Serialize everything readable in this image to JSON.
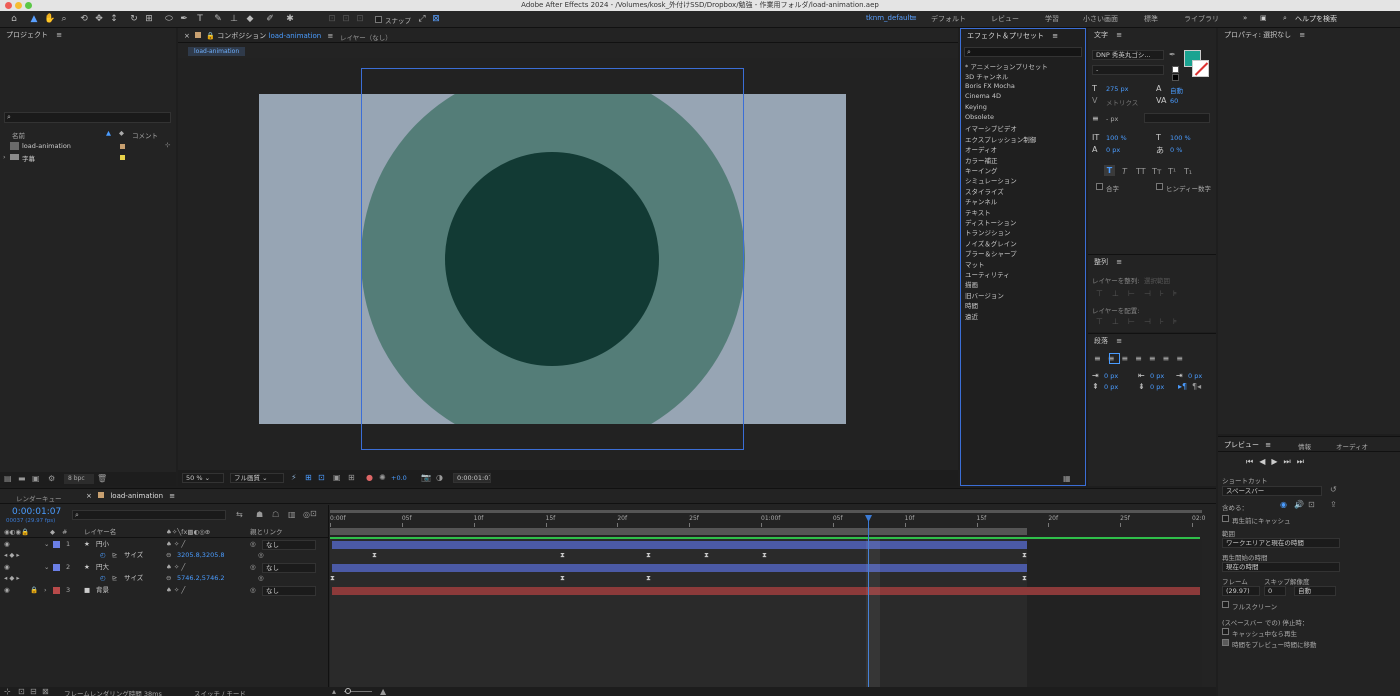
{
  "window": {
    "title": "Adobe After Effects 2024 - /Volumes/kosk_外付けSSD/Dropbox/勉強 - 作業用フォルダ/load-animation.aep"
  },
  "toolbar": {
    "snap_label": "スナップ",
    "workspaces": [
      "tknm_default",
      "デフォルト",
      "レビュー",
      "学習",
      "小さい画面",
      "標準",
      "ライブラリ"
    ],
    "active_workspace": "tknm_default",
    "help_placeholder": "ヘルプを検索"
  },
  "project": {
    "title": "プロジェクト",
    "search_placeholder": "",
    "col_name": "名前",
    "col_comment": "コメント",
    "items": [
      {
        "name": "load-animation",
        "type": "composition",
        "label_color": "#c8a070"
      },
      {
        "name": "字幕",
        "type": "folder",
        "label_color": "#e8d24a"
      }
    ],
    "bpc": "8 bpc"
  },
  "composition": {
    "tab_title": "コンポジション",
    "tab_name": "load-animation",
    "layer_tab": "レイヤー（なし）",
    "breadcrumb": "load-animation",
    "zoom": "50 %",
    "quality": "フル画質",
    "exposure": "+0.0",
    "timecode": "0:00:01:07",
    "colors": {
      "background": "#97a5b4",
      "outer_circle": "#547d78",
      "inner_circle": "#123a34"
    }
  },
  "effects": {
    "title": "エフェクト＆プリセット",
    "items": [
      "* アニメーションプリセット",
      "3D チャンネル",
      "Boris FX Mocha",
      "Cinema 4D",
      "Keying",
      "Obsolete",
      "イマーシブビデオ",
      "エクスプレッション制御",
      "オーディオ",
      "カラー補正",
      "キーイング",
      "シミュレーション",
      "スタイライズ",
      "チャンネル",
      "テキスト",
      "ディストーション",
      "トランジション",
      "ノイズ＆グレイン",
      "ブラー＆シャープ",
      "マット",
      "ユーティリティ",
      "描画",
      "旧バージョン",
      "時間",
      "遠近"
    ]
  },
  "character": {
    "title": "文字",
    "font": "DNP 秀英丸ゴシ...",
    "font_style": "-",
    "size": "275 px",
    "leading": "自動",
    "kerning": "メトリクス",
    "tracking": "60",
    "stroke": "- px",
    "vscale": "100 %",
    "hscale": "100 %",
    "baseline": "0 px",
    "tsume": "0 %",
    "fill_color": "#1aa391",
    "ligature_label": "合字",
    "hindi_label": "ヒンディー数字"
  },
  "align": {
    "title": "整列",
    "align_to_label": "レイヤーを整列:",
    "align_to_value": "選択範囲",
    "distribute_label": "レイヤーを配置:"
  },
  "paragraph": {
    "title": "段落",
    "values": [
      "0 px",
      "0 px",
      "0 px",
      "0 px",
      "0 px"
    ]
  },
  "properties": {
    "title": "プロパティ: 選択なし"
  },
  "preview": {
    "tabs": [
      "プレビュー",
      "情報",
      "オーディオ"
    ],
    "shortcut_label": "ショートカット",
    "shortcut_value": "スペースバー",
    "include_label": "含める：",
    "cache_label": "再生前にキャッシュ",
    "range_label": "範囲",
    "range_value": "ワークエリアと現在の時間",
    "start_label": "再生開始の時間",
    "start_value": "現在の時間",
    "frame_label": "フレーム",
    "skip_label": "スキップ",
    "resolution_label": "解像度",
    "frame_value": "(29.97)",
    "skip_value": "0",
    "resolution_value": "自動",
    "fullscreen_label": "フルスクリーン",
    "stop_label": "(スペースバー での) 停止時：",
    "stop_cache_label": "キャッシュ中なら再生",
    "stop_move_label": "時間をプレビュー時間に移動"
  },
  "timeline": {
    "render_queue_tab": "レンダーキュー",
    "comp_tab": "load-animation",
    "timecode": "0:00:01:07",
    "fps_info": "00037 (29.97 fps)",
    "col_layer_name": "レイヤー名",
    "col_parent": "親とリンク",
    "ruler": [
      "0:00f",
      "05f",
      "10f",
      "15f",
      "20f",
      "25f",
      "01:00f",
      "05f",
      "10f",
      "15f",
      "20f",
      "25f",
      "02:0"
    ],
    "layers": [
      {
        "num": "1",
        "name": "円小",
        "color": "#6b7fe6",
        "parent": "なし",
        "prop": "サイズ",
        "prop_value": "3205.8,3205.8",
        "bar_color": "#4b5aa6"
      },
      {
        "num": "2",
        "name": "円大",
        "color": "#6b7fe6",
        "parent": "なし",
        "prop": "サイズ",
        "prop_value": "5746.2,5746.2",
        "bar_color": "#4b5aa6"
      },
      {
        "num": "3",
        "name": "背景",
        "color": "#b84a4a",
        "parent": "なし",
        "bar_color": "#8c3a3a"
      }
    ],
    "render_time": "フレームレンダリング時間 38ms",
    "switch_mode": "スイッチ / モード",
    "playhead_fraction": 0.617
  }
}
